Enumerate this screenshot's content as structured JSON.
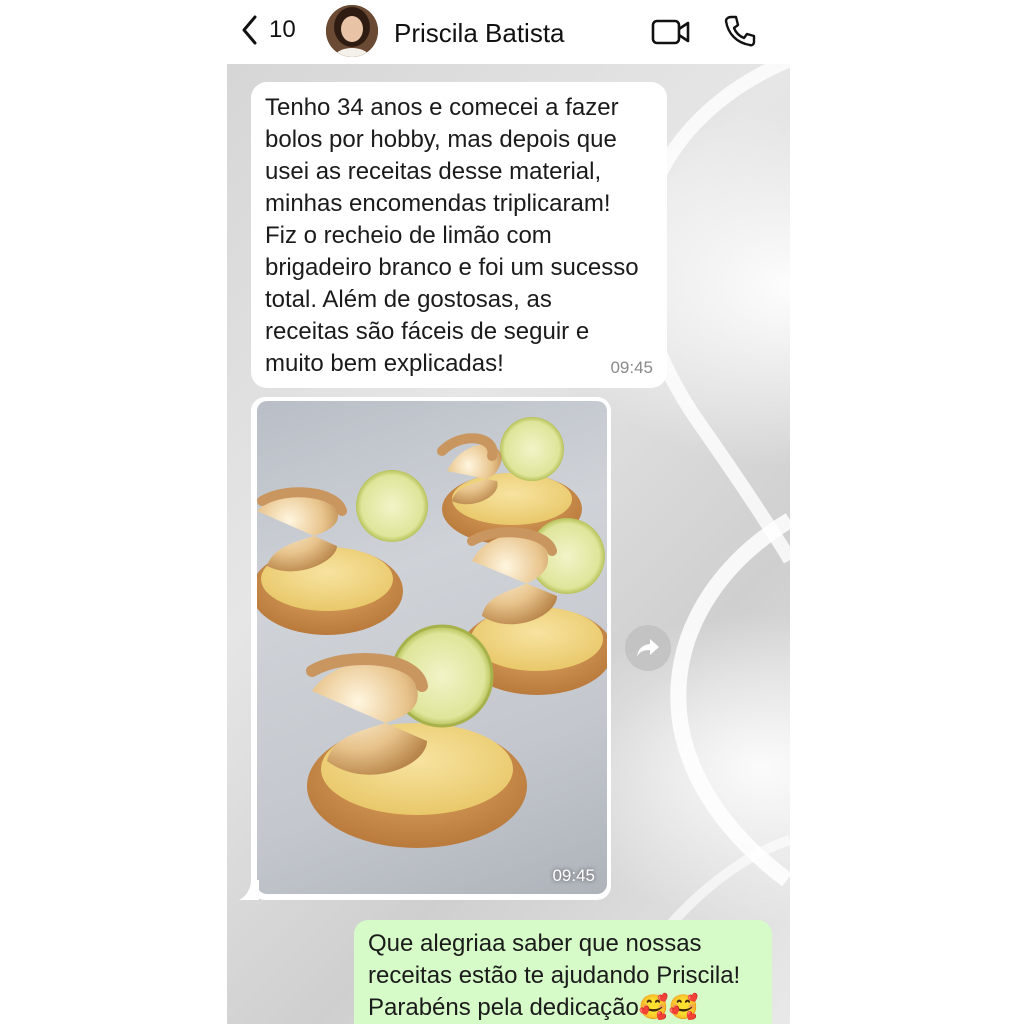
{
  "header": {
    "back_count": "10",
    "contact_name": "Priscila Batista"
  },
  "messages": [
    {
      "direction": "incoming",
      "type": "text",
      "text": "Tenho 34 anos e comecei a fazer\nbolos por hobby, mas depois que\nusei as receitas desse material,\nminhas encomendas triplicaram!\nFiz o recheio de limão com\nbrigadeiro branco e foi um sucesso\ntotal. Além de gostosas, as\nreceitas são fáceis de seguir e\nmuito bem explicadas!",
      "time": "09:45"
    },
    {
      "direction": "incoming",
      "type": "image",
      "image_subject": "lemon tartlets with toasted meringue and lime slices",
      "time": "09:45"
    },
    {
      "direction": "outgoing",
      "type": "text",
      "text": "Que alegriaa saber que nossas\nreceitas estão te ajudando Priscila!\nParabéns pela dedicação🥰🥰"
    }
  ],
  "icons": {
    "back": "chevron-left-icon",
    "video": "video-camera-icon",
    "call": "phone-icon",
    "forward": "forward-arrow-icon"
  },
  "colors": {
    "incoming_bubble": "#ffffff",
    "outgoing_bubble": "#d6fbc8",
    "header_bg": "#ffffff",
    "chat_bg": "#dcdcdc"
  }
}
